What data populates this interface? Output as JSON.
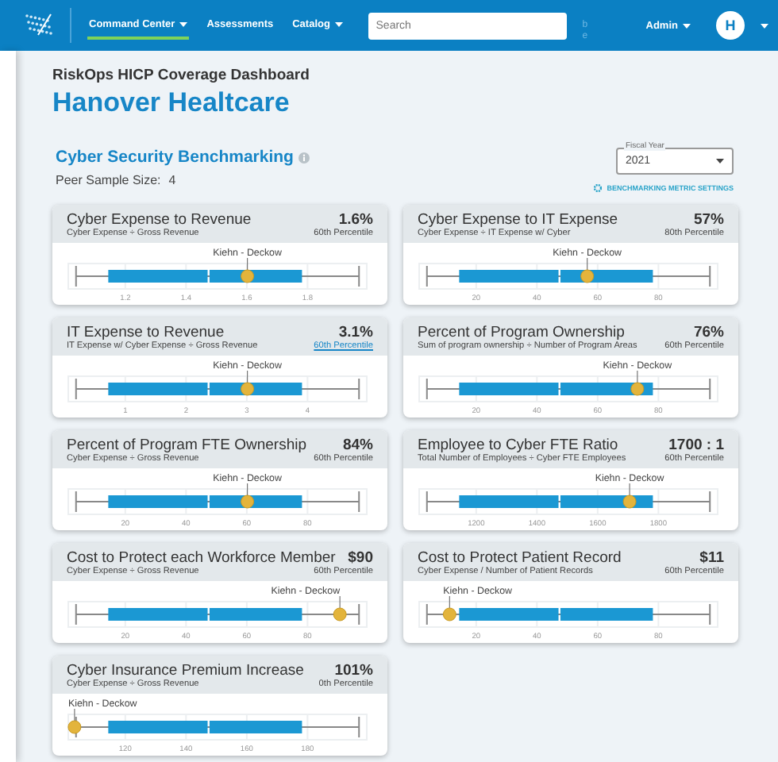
{
  "nav": {
    "items": [
      {
        "label": "Command Center",
        "selected": true,
        "dropdown": true
      },
      {
        "label": "Assessments",
        "selected": false,
        "dropdown": false
      },
      {
        "label": "Catalog",
        "selected": false,
        "dropdown": true
      }
    ],
    "search": {
      "placeholder": "Search"
    },
    "stray_text": "be",
    "user": {
      "name": "Admin",
      "initial": "H"
    }
  },
  "page": {
    "subtitle": "RiskOps HICP Coverage Dashboard",
    "title": "Hanover Healtcare"
  },
  "section": {
    "title": "Cyber Security Benchmarking",
    "peer_label": "Peer Sample Size:",
    "peer_value": "4",
    "fiscal_year": {
      "label": "Fiscal Year",
      "value": "2021"
    },
    "settings_link": "BENCHMARKING METRIC SETTINGS"
  },
  "cards": [
    {
      "title": "Cyber Expense to Revenue",
      "formula": "Cyber Expense ÷ Gross Revenue",
      "value": "1.6%",
      "percentile": "60th Percentile",
      "underlined": false,
      "plot": {
        "ticks": [
          "1.2",
          "1.4",
          "1.6",
          "1.8"
        ],
        "marker": {
          "label": "Kiehn - Deckow",
          "level": 0.6
        }
      }
    },
    {
      "title": "Cyber Expense to IT Expense",
      "formula": "Cyber Expense ÷ IT Expense w/ Cyber",
      "value": "57%",
      "percentile": "80th Percentile",
      "underlined": false,
      "plot": {
        "ticks": [
          "20",
          "40",
          "60",
          "80"
        ],
        "marker": {
          "label": "Kiehn - Deckow",
          "level": 0.563
        }
      }
    },
    {
      "title": "IT Expense to Revenue",
      "formula": "IT Expense w/ Cyber Expense ÷ Gross Revenue",
      "value": "3.1%",
      "percentile": "60th Percentile",
      "underlined": true,
      "plot": {
        "ticks": [
          "1",
          "2",
          "3",
          "4"
        ],
        "marker": {
          "label": "Kiehn - Deckow",
          "level": 0.6
        }
      }
    },
    {
      "title": "Percent of Program Ownership",
      "formula": "Sum of program ownership ÷ Number of Program Areas",
      "value": "76%",
      "percentile": "60th Percentile",
      "underlined": false,
      "plot": {
        "ticks": [
          "20",
          "40",
          "60",
          "80"
        ],
        "marker": {
          "label": "Kiehn - Deckow",
          "level": 0.731
        }
      }
    },
    {
      "title": "Percent of Program FTE Ownership",
      "formula": "Cyber Expense ÷ Gross Revenue",
      "value": "84%",
      "percentile": "60th Percentile",
      "underlined": false,
      "plot": {
        "ticks": [
          "20",
          "40",
          "60",
          "80"
        ],
        "marker": {
          "label": "Kiehn - Deckow",
          "level": 0.6
        }
      }
    },
    {
      "title": "Employee to Cyber FTE Ratio",
      "formula": "Total Number of Employees ÷ Cyber FTE Employees",
      "value": "1700 : 1",
      "percentile": "60th Percentile",
      "underlined": false,
      "plot": {
        "ticks": [
          "1200",
          "1400",
          "1600",
          "1800"
        ],
        "marker": {
          "label": "Kiehn - Deckow",
          "level": 0.705
        }
      }
    },
    {
      "title": "Cost to Protect each Workforce Member",
      "formula": "Cyber Expense ÷ Gross Revenue",
      "value": "$90",
      "percentile": "60th Percentile",
      "underlined": false,
      "plot": {
        "ticks": [
          "20",
          "40",
          "60",
          "80"
        ],
        "marker": {
          "label": "Kiehn - Deckow",
          "level": 0.91
        }
      }
    },
    {
      "title": "Cost to Protect Patient Record",
      "formula": "Cyber Expense / Number of Patient Records",
      "value": "$11",
      "percentile": "60th Percentile",
      "underlined": false,
      "plot": {
        "ticks": [
          "20",
          "40",
          "60",
          "80"
        ],
        "marker": {
          "label": "Kiehn - Deckow",
          "level": 0.102
        }
      }
    },
    {
      "title": "Cyber Insurance Premium Increase",
      "formula": "Cyber Expense ÷ Gross Revenue",
      "value": "101%",
      "percentile": "0th Percentile",
      "underlined": false,
      "plot": {
        "ticks": [
          "120",
          "140",
          "160",
          "180"
        ],
        "marker": {
          "label": "Kiehn - Deckow",
          "level": 0.021
        }
      }
    }
  ]
}
